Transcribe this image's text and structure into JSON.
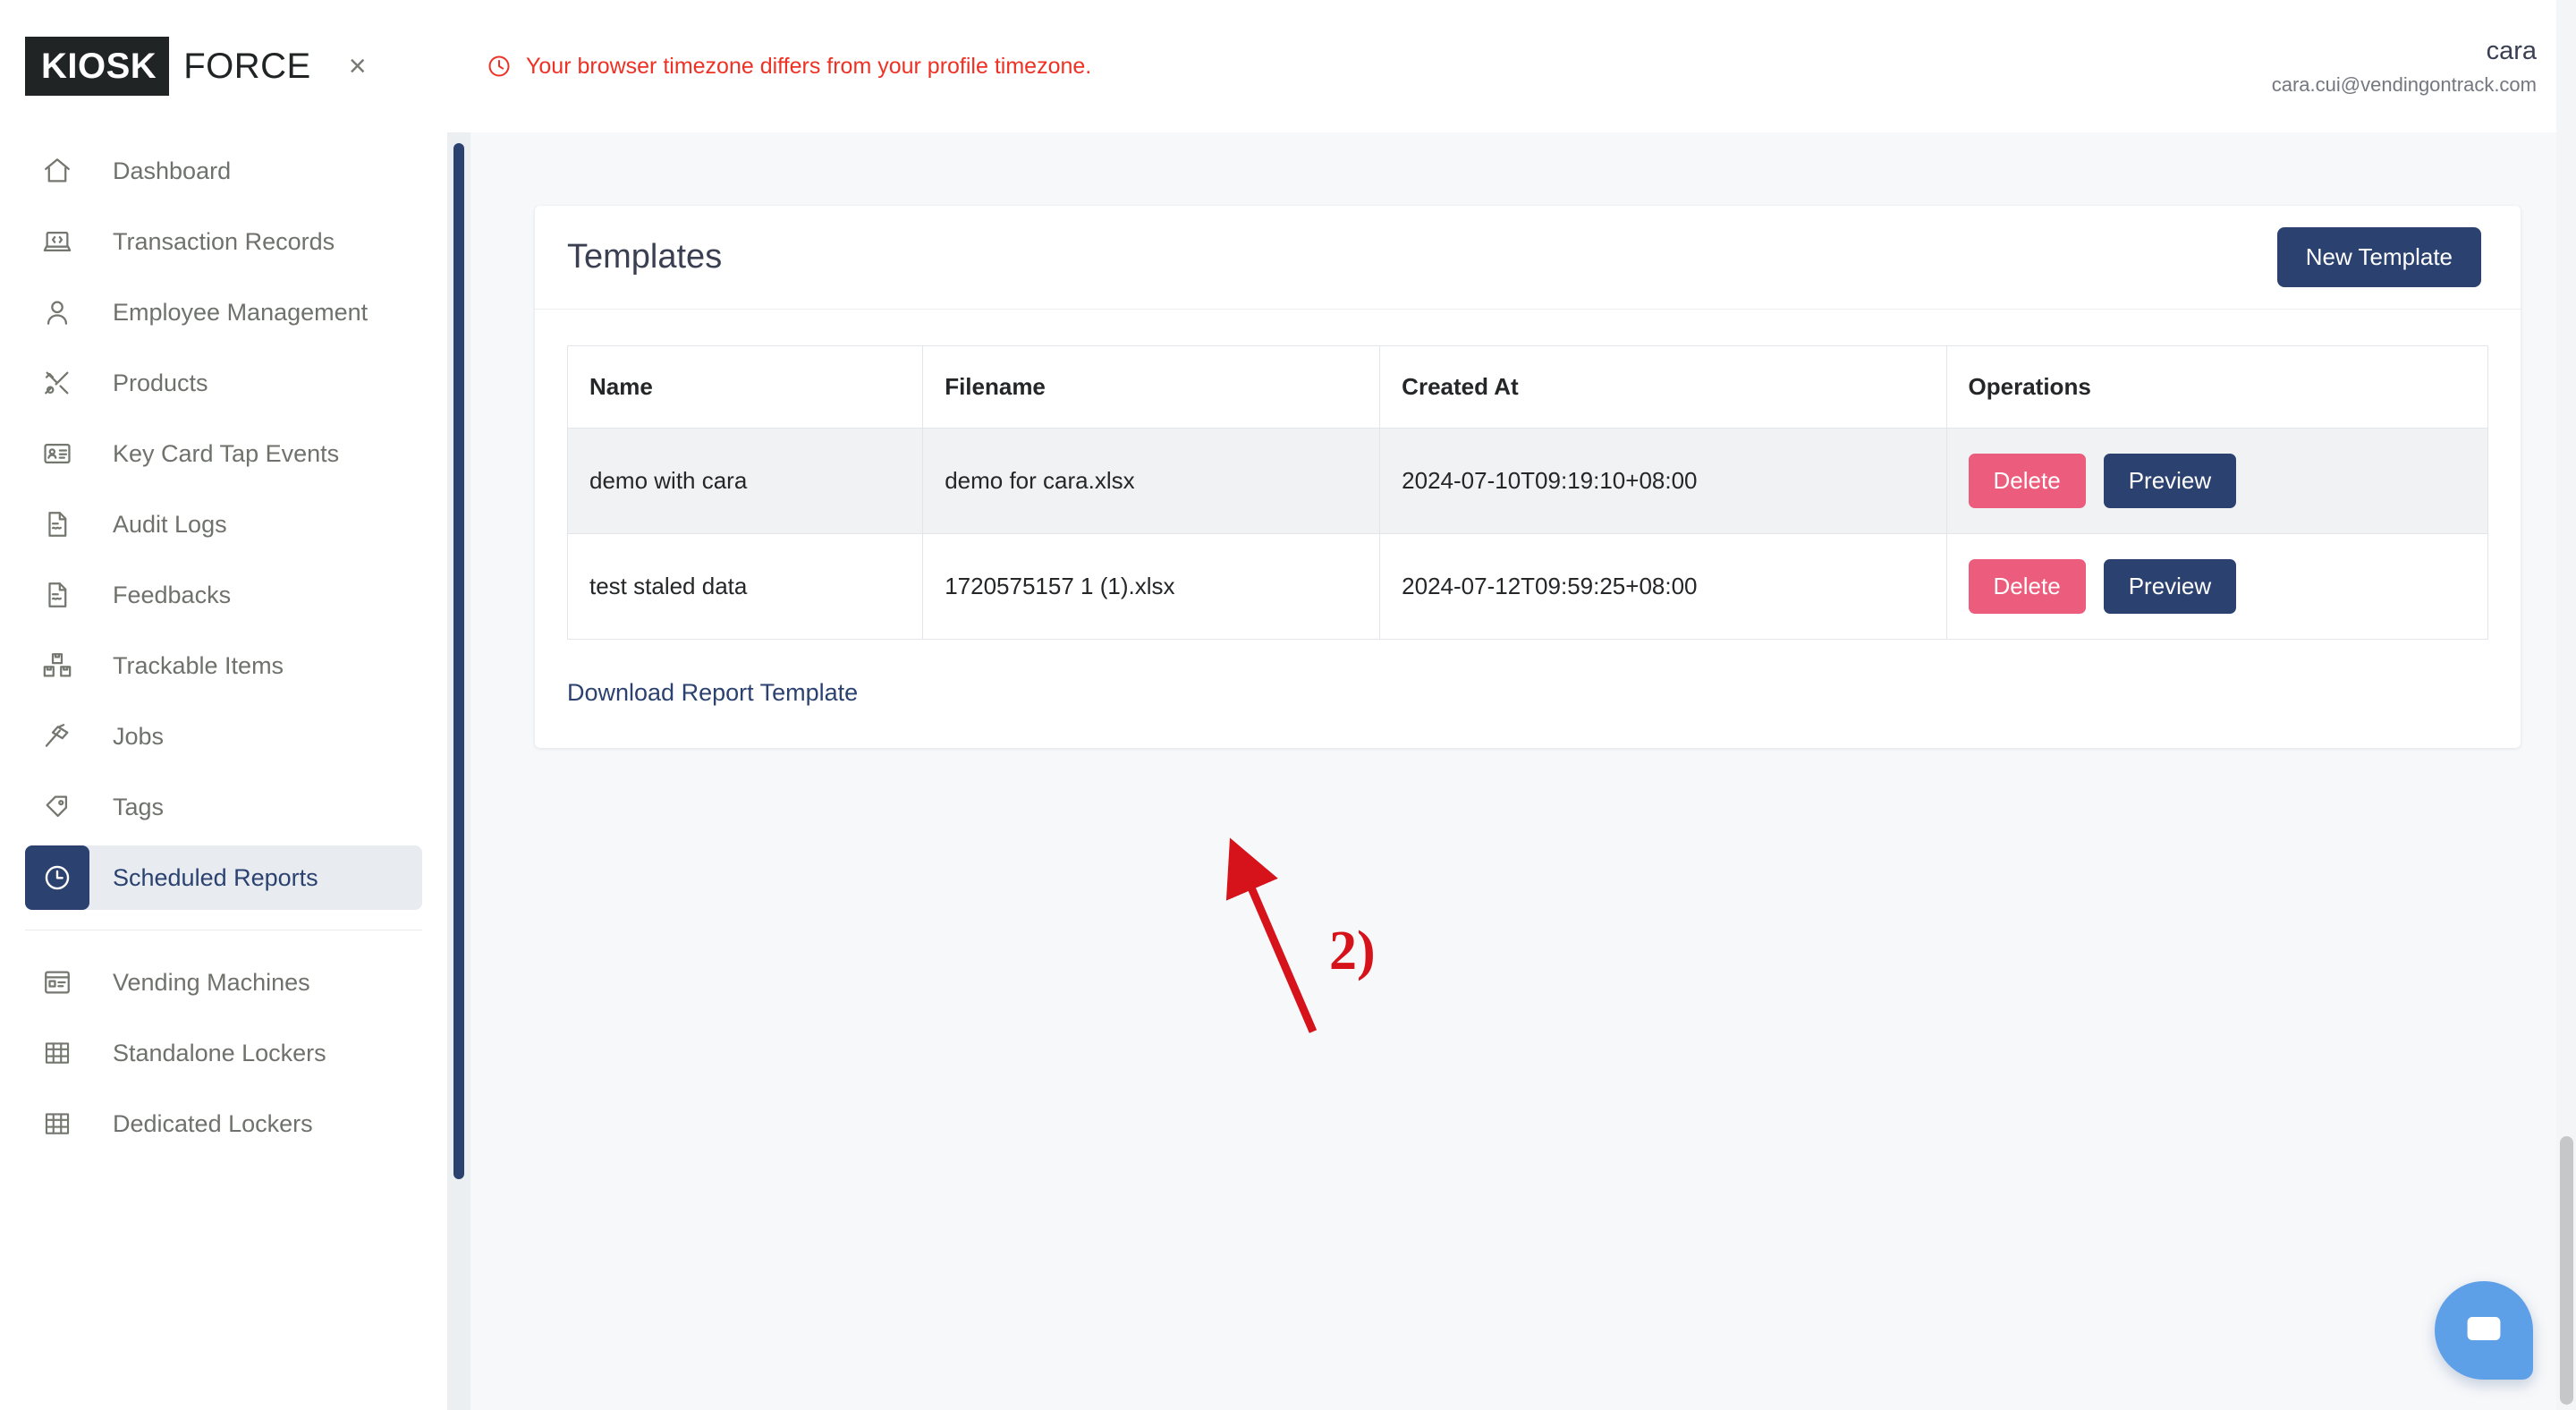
{
  "brand": {
    "logo_primary": "KIOSK",
    "logo_secondary": "FORCE",
    "close_label": "×"
  },
  "sidebar": {
    "items": [
      {
        "label": "Dashboard",
        "icon": "home-icon",
        "active": false
      },
      {
        "label": "Transaction Records",
        "icon": "laptop-code-icon",
        "active": false
      },
      {
        "label": "Employee Management",
        "icon": "user-icon",
        "active": false
      },
      {
        "label": "Products",
        "icon": "tools-icon",
        "active": false
      },
      {
        "label": "Key Card Tap Events",
        "icon": "id-card-icon",
        "active": false
      },
      {
        "label": "Audit Logs",
        "icon": "document-signature-icon",
        "active": false
      },
      {
        "label": "Feedbacks",
        "icon": "document-signature-icon",
        "active": false
      },
      {
        "label": "Trackable Items",
        "icon": "boxes-icon",
        "active": false
      },
      {
        "label": "Jobs",
        "icon": "hammer-icon",
        "active": false
      },
      {
        "label": "Tags",
        "icon": "tag-icon",
        "active": false
      },
      {
        "label": "Scheduled Reports",
        "icon": "clock-icon",
        "active": true
      }
    ],
    "items_secondary": [
      {
        "label": "Vending Machines",
        "icon": "vending-machine-icon",
        "active": false
      },
      {
        "label": "Standalone Lockers",
        "icon": "grid-icon",
        "active": false
      },
      {
        "label": "Dedicated Lockers",
        "icon": "grid-icon",
        "active": false
      }
    ]
  },
  "topbar": {
    "warning_text": "Your browser timezone differs from your profile timezone.",
    "warning_icon": "clock-alert-icon",
    "warning_color": "#ee3124",
    "user_name": "cara",
    "user_email": "cara.cui@vendingontrack.com"
  },
  "card": {
    "title": "Templates",
    "new_template_label": "New Template",
    "download_link_label": "Download Report Template",
    "table": {
      "columns": [
        "Name",
        "Filename",
        "Created At",
        "Operations"
      ],
      "rows": [
        {
          "name": "demo with cara",
          "filename": "demo for cara.xlsx",
          "created_at": "2024-07-10T09:19:10+08:00",
          "delete_label": "Delete",
          "preview_label": "Preview"
        },
        {
          "name": "test staled data",
          "filename": "1720575157 1 (1).xlsx",
          "created_at": "2024-07-12T09:59:25+08:00",
          "delete_label": "Delete",
          "preview_label": "Preview"
        }
      ]
    }
  },
  "annotation": {
    "step_label": "2)",
    "color": "#d6131b"
  },
  "chat": {
    "icon": "chat-bubble-icon",
    "color": "#5da0e8"
  },
  "theme": {
    "navy": "#2b4270",
    "danger": "#ec5c7d",
    "warning_red": "#ee3124",
    "page_bg": "#f7f8fa",
    "active_nav_bg": "#e8ecf1"
  }
}
